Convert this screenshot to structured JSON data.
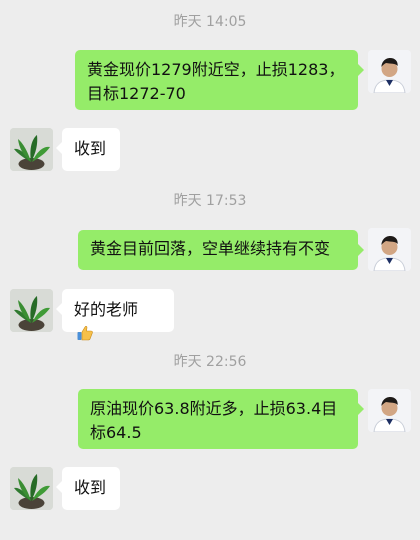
{
  "messages": [
    {
      "type": "timestamp",
      "text": "昨天 14:05"
    },
    {
      "type": "outgoing",
      "lines": [
        "黄金现价1279附近空，止损1283，",
        "目标1272-70"
      ]
    },
    {
      "type": "incoming",
      "text": "收到"
    },
    {
      "type": "timestamp",
      "text": "昨天 17:53"
    },
    {
      "type": "outgoing",
      "lines": [
        "黄金目前回落，空单继续持有不变"
      ]
    },
    {
      "type": "incoming",
      "text": "好的老师",
      "emoji": "thumbs-up"
    },
    {
      "type": "timestamp",
      "text": "昨天 22:56"
    },
    {
      "type": "outgoing",
      "lines": [
        "原油现价63.8附近多，止损63.4目",
        "标64.5"
      ]
    },
    {
      "type": "incoming",
      "text": "收到"
    }
  ],
  "colors": {
    "background": "#ededed",
    "outgoing_bubble": "#95ec69",
    "incoming_bubble": "#ffffff",
    "timestamp_text": "#a0a0a0"
  },
  "icons": {
    "sender_avatar": "person-avatar-icon",
    "receiver_avatar": "plant-avatar-icon",
    "emoji": "thumbs-up-icon"
  }
}
